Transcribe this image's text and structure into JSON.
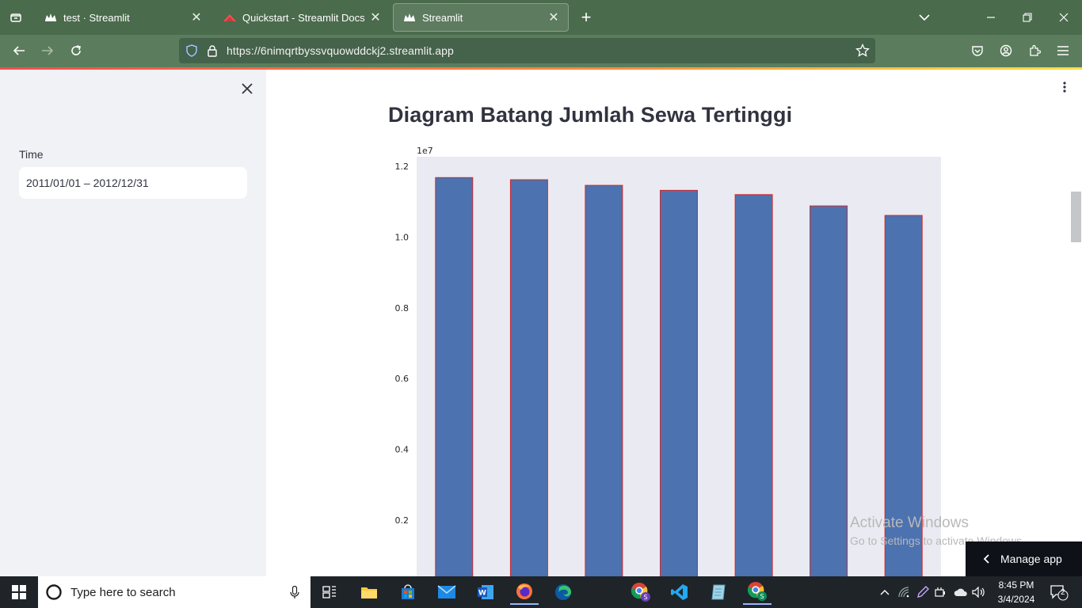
{
  "browser": {
    "tabs": [
      {
        "title": "test · Streamlit"
      },
      {
        "title": "Quickstart - Streamlit Docs"
      },
      {
        "title": "Streamlit"
      }
    ],
    "url": "https://6nimqrtbyssvquowddckj2.streamlit.app"
  },
  "sidebar": {
    "time_label": "Time",
    "time_value": "2011/01/01 – 2012/12/31"
  },
  "main": {
    "title": "Diagram Batang Jumlah Sewa Tertinggi"
  },
  "chart_data": {
    "type": "bar",
    "values": [
      11.68,
      11.62,
      11.46,
      11.32,
      11.2,
      10.88,
      10.61
    ],
    "ylim_visible": [
      0.08,
      1.23
    ],
    "y_ticks": [
      "1.2",
      "1.0",
      "0.8",
      "0.6",
      "0.4",
      "0.2"
    ],
    "y_tick_values": [
      1.2,
      1.0,
      0.8,
      0.6,
      0.4,
      0.2
    ],
    "y_offset_label": "1e7",
    "bar_color": "#4c72b0",
    "bar_edge_color": "#d62728",
    "plot_background": "#eaeaf2",
    "grid": false
  },
  "watermark": {
    "title": "Activate Windows",
    "subtitle": "Go to Settings to activate Windows."
  },
  "manage_app": "Manage app",
  "taskbar": {
    "search_placeholder": "Type here to search",
    "time": "8:45 PM",
    "date": "3/4/2024",
    "notification_count": "2"
  }
}
